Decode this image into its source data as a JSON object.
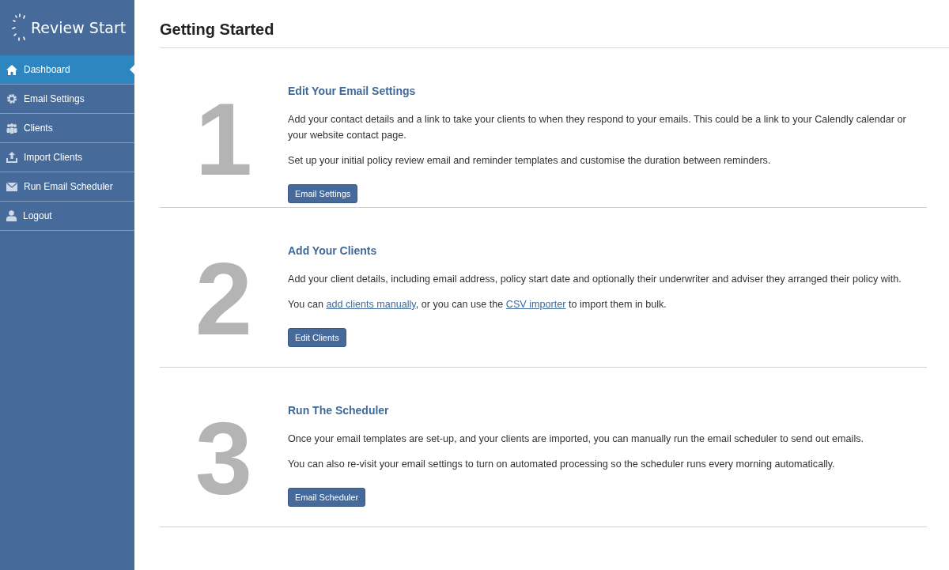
{
  "sidebar": {
    "logo": "Review Start",
    "items": [
      {
        "label": "Dashboard",
        "selected": true
      },
      {
        "label": "Email Settings",
        "selected": false
      },
      {
        "label": "Clients",
        "selected": false
      },
      {
        "label": "Import Clients",
        "selected": false
      },
      {
        "label": "Run Email Scheduler",
        "selected": false
      },
      {
        "label": "Logout",
        "selected": false
      }
    ]
  },
  "page_title": "Getting Started",
  "steps": [
    {
      "number": "1",
      "title": "Edit Your Email Settings",
      "paragraphs": [
        [
          {
            "text": "Add your contact details and a link to take your clients to when they respond to your emails. This could be a link to your Calendly calendar or your website contact page."
          }
        ],
        [
          {
            "text": "Set up your initial policy review email and reminder templates and customise the duration between reminders."
          }
        ]
      ],
      "button": "Email Settings"
    },
    {
      "number": "2",
      "title": "Add Your Clients",
      "paragraphs": [
        [
          {
            "text": "Add your client details, including email address, policy start date and optionally their underwriter and adviser they arranged their policy with."
          }
        ],
        [
          {
            "text": "You can "
          },
          {
            "link": "add clients manually"
          },
          {
            "text": ", or you can use the "
          },
          {
            "link": "CSV importer"
          },
          {
            "text": " to import them in bulk."
          }
        ]
      ],
      "button": "Edit Clients"
    },
    {
      "number": "3",
      "title": "Run The Scheduler",
      "paragraphs": [
        [
          {
            "text": "Once your email templates are set-up, and your clients are imported, you can manually run the email scheduler to send out emails."
          }
        ],
        [
          {
            "text": "You can also re-visit your email settings to turn on automated processing so the scheduler runs every morning automatically."
          }
        ]
      ],
      "button": "Email Scheduler"
    }
  ]
}
